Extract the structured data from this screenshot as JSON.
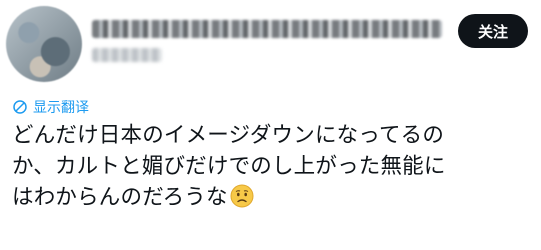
{
  "tweet": {
    "follow_label": "关注",
    "translate_label": "显示翻译",
    "text_lines": [
      "どんだけ日本のイメージダウンになってるの",
      "か、カルトと媚びだけでのし上がった無能に",
      "はわからんのだろうな"
    ],
    "emoji": "worried-face"
  }
}
